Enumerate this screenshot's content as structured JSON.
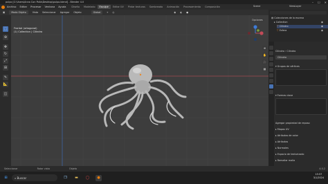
{
  "window": {
    "title": "pulpo [C:\\Users\\Anna Con Pollo\\Desktop\\pulpo.blend] - Blender 4.0"
  },
  "menu": [
    "Archivo",
    "Editar",
    "Procesar",
    "Ventana",
    "Ayuda"
  ],
  "workspaces": [
    "Diseño",
    "Modelado",
    "Esculpir",
    "Editar UV",
    "Pintar texturas",
    "Sombreado",
    "Animación",
    "Procesamiento",
    "Composición"
  ],
  "active_workspace": "Esculpir",
  "header": {
    "mode": "Modo Objeto",
    "menus": [
      "Vista",
      "Seleccionar",
      "Agregar",
      "Objeto"
    ],
    "transform": "Global",
    "options": "Opciones"
  },
  "viewport": {
    "line1": "Frontal (ortogonal)",
    "line2": "(1) Collection | Cilindro"
  },
  "scene": {
    "name": "Scene",
    "layer": "ViewLayer"
  },
  "outliner": {
    "root": "Colecciones de la escena",
    "collection": "Collection",
    "items": [
      "Cilindro",
      "Esfera"
    ]
  },
  "properties": {
    "object": "Cilindro",
    "data": "Cilindro",
    "groups_title": "Grupos de vértices",
    "shapes_title": "Formas clave",
    "sections": [
      "Agregar propiedad de reposo",
      "Mapas UV",
      "Atributos de color",
      "Atributos",
      "Normales",
      "Espacio de texturizado",
      "Remallar malla"
    ]
  },
  "status": [
    "Seleccionar",
    "Rotar vista",
    "Objeto"
  ],
  "version": "4.0.2",
  "taskbar": {
    "search": "Buscar",
    "time": "15:57",
    "date": "3/1/2024"
  },
  "colors": {
    "accent": "#4772b3",
    "orange": "#e87d0d",
    "x_axis": "#c24b58",
    "y_axis": "#7da33a",
    "z_axis": "#3e7bd6"
  }
}
